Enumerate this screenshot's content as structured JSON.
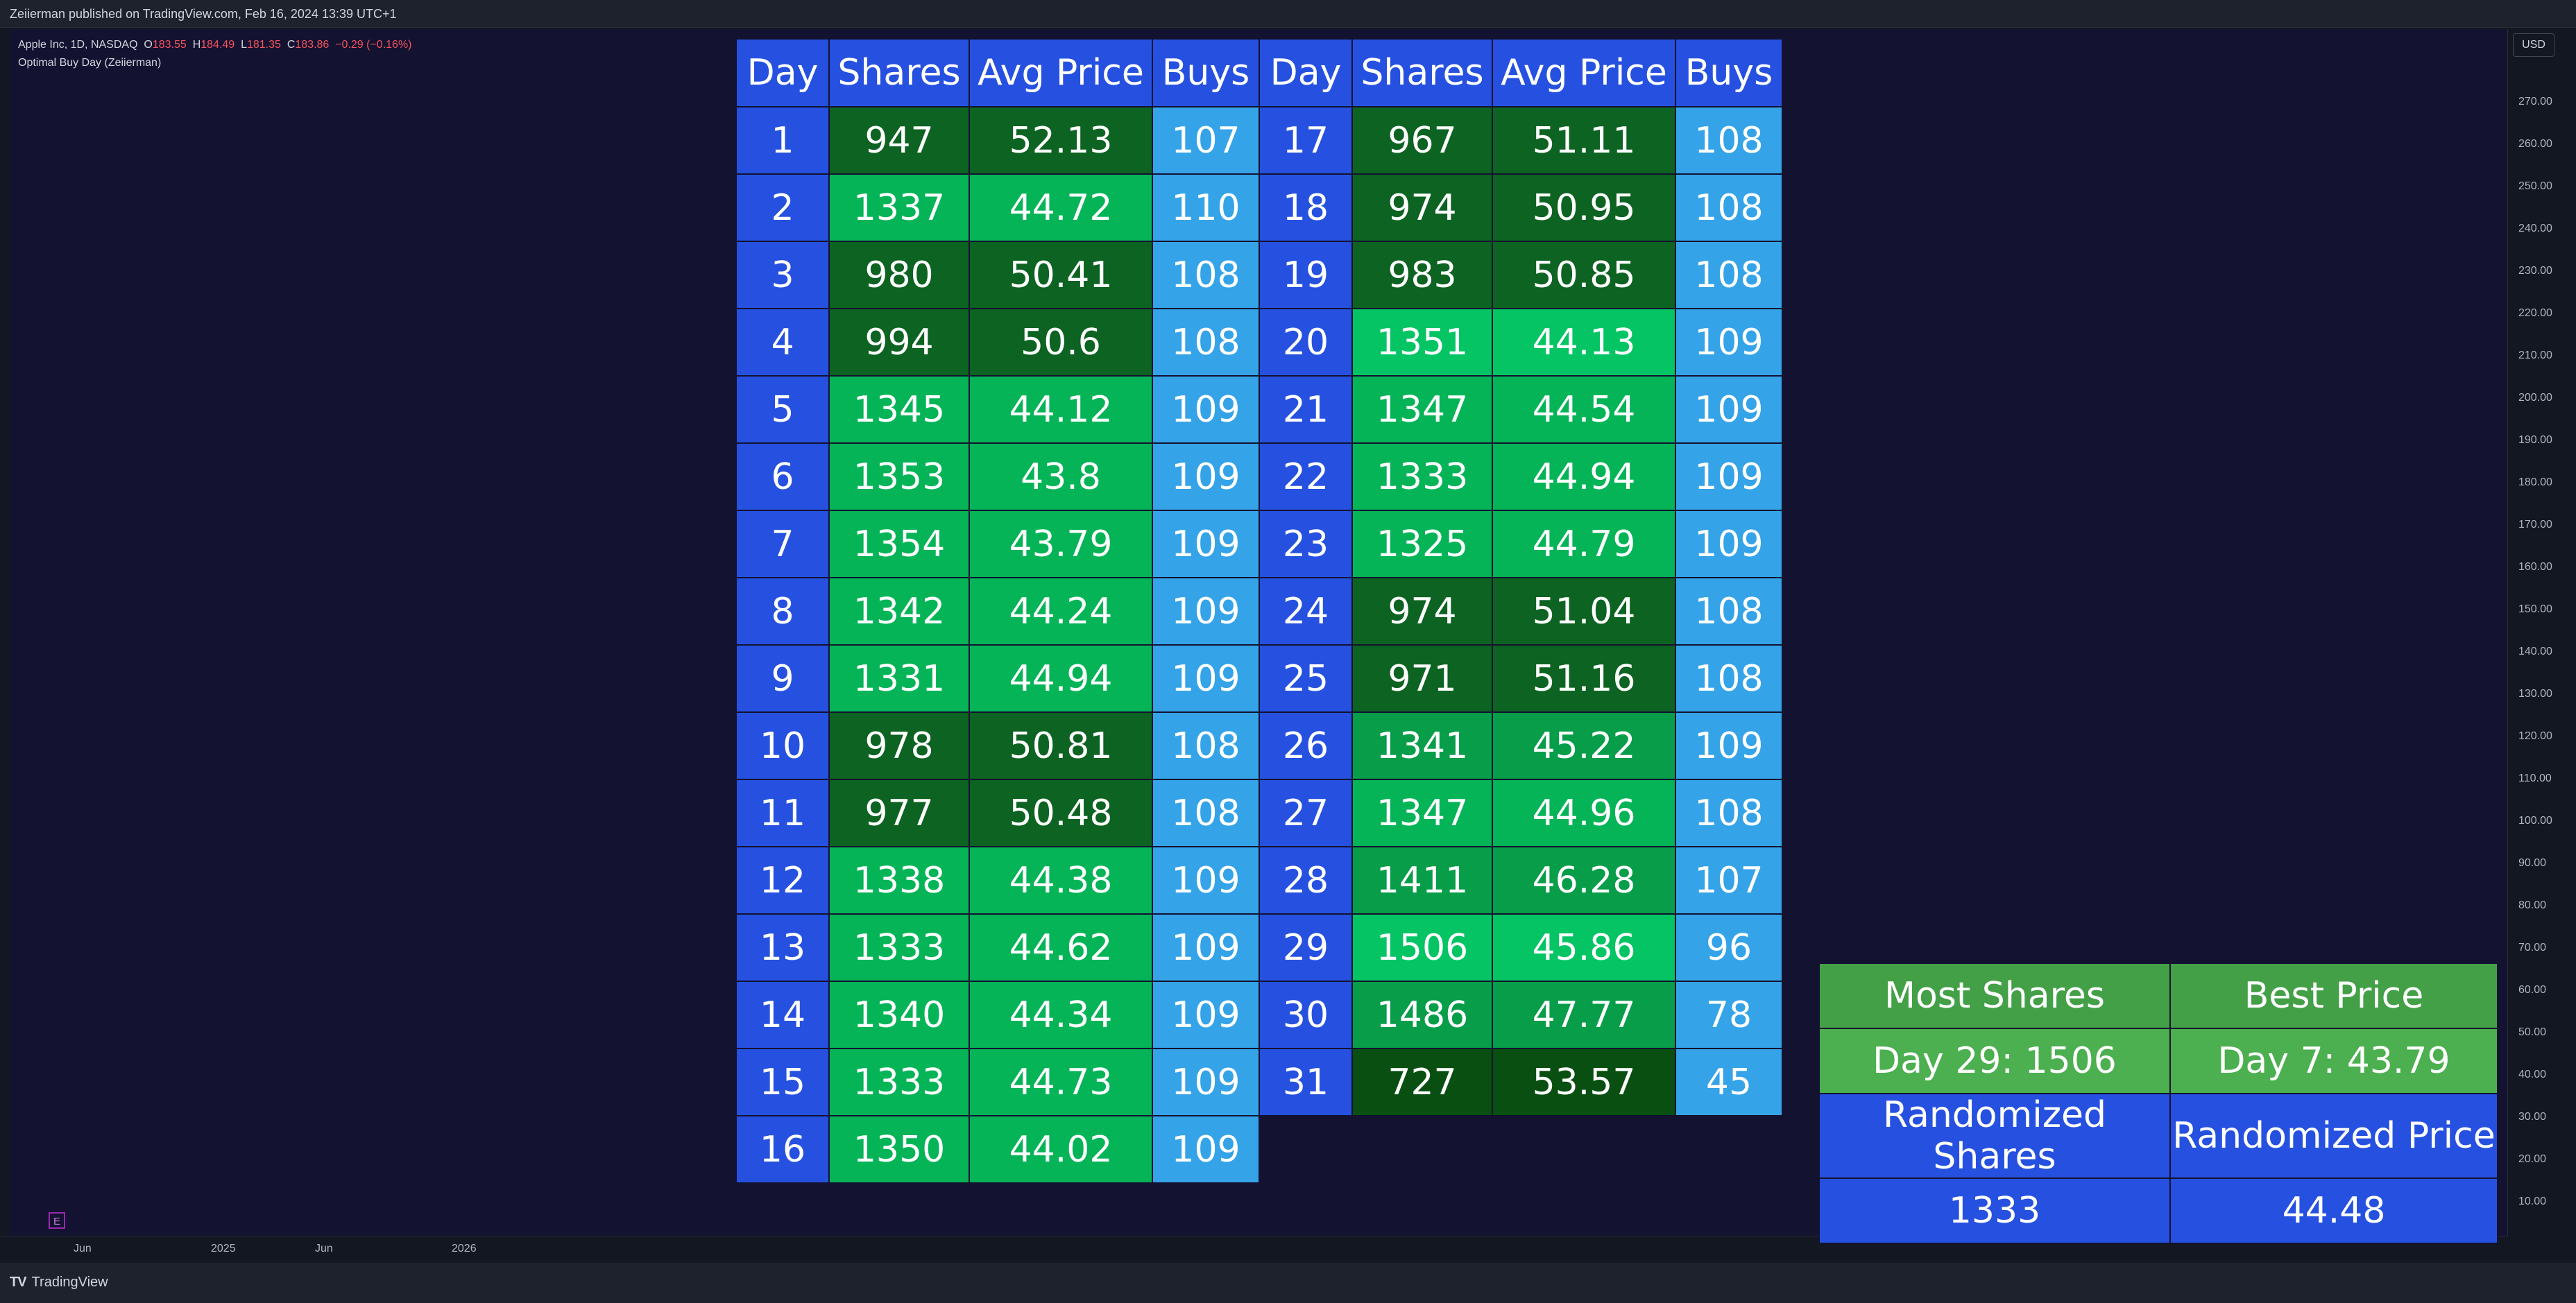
{
  "header": {
    "publish_line": "Zeiierman published on TradingView.com, Feb 16, 2024 13:39 UTC+1"
  },
  "legend": {
    "symbol": "Apple Inc, 1D, NASDAQ",
    "o_label": "O",
    "o": "183.55",
    "h_label": "H",
    "h": "184.49",
    "l_label": "L",
    "l": "181.35",
    "c_label": "C",
    "c": "183.86",
    "change": "−0.29 (−0.16%)",
    "indicator": "Optimal Buy Day (Zeiierman)"
  },
  "price_axis": {
    "currency": "USD",
    "ticks": [
      "270.00",
      "260.00",
      "250.00",
      "240.00",
      "230.00",
      "220.00",
      "210.00",
      "200.00",
      "190.00",
      "180.00",
      "170.00",
      "160.00",
      "150.00",
      "140.00",
      "130.00",
      "120.00",
      "110.00",
      "100.00",
      "90.00",
      "80.00",
      "70.00",
      "60.00",
      "50.00",
      "40.00",
      "30.00",
      "20.00",
      "10.00"
    ]
  },
  "time_axis": {
    "ticks": [
      "Jun",
      "2025",
      "Jun",
      "2026"
    ]
  },
  "earnings_badge": "E",
  "footer": {
    "logo_mark": "TV",
    "logo_text": "TradingView"
  },
  "colors": {
    "day": "#2651e0",
    "buys": "#35a3e8",
    "shares_scale": [
      "#0a4f12",
      "#0d6321",
      "#0a7a2c",
      "#079d49",
      "#05b457",
      "#04c464"
    ]
  },
  "table": {
    "headers": [
      "Day",
      "Shares",
      "Avg Price",
      "Buys",
      "Day",
      "Shares",
      "Avg Price",
      "Buys"
    ],
    "left": [
      {
        "day": "1",
        "shares": "947",
        "avg": "52.13",
        "buys": "107",
        "shade": 1,
        "bshade": 0
      },
      {
        "day": "2",
        "shares": "1337",
        "avg": "44.72",
        "buys": "110",
        "shade": 4,
        "bshade": 0
      },
      {
        "day": "3",
        "shares": "980",
        "avg": "50.41",
        "buys": "108",
        "shade": 1,
        "bshade": 0
      },
      {
        "day": "4",
        "shares": "994",
        "avg": "50.6",
        "buys": "108",
        "shade": 1,
        "bshade": 0
      },
      {
        "day": "5",
        "shares": "1345",
        "avg": "44.12",
        "buys": "109",
        "shade": 4,
        "bshade": 0
      },
      {
        "day": "6",
        "shares": "1353",
        "avg": "43.8",
        "buys": "109",
        "shade": 4,
        "bshade": 0
      },
      {
        "day": "7",
        "shares": "1354",
        "avg": "43.79",
        "buys": "109",
        "shade": 4,
        "bshade": 0
      },
      {
        "day": "8",
        "shares": "1342",
        "avg": "44.24",
        "buys": "109",
        "shade": 4,
        "bshade": 0
      },
      {
        "day": "9",
        "shares": "1331",
        "avg": "44.94",
        "buys": "109",
        "shade": 4,
        "bshade": 0
      },
      {
        "day": "10",
        "shares": "978",
        "avg": "50.81",
        "buys": "108",
        "shade": 1,
        "bshade": 0
      },
      {
        "day": "11",
        "shares": "977",
        "avg": "50.48",
        "buys": "108",
        "shade": 1,
        "bshade": 0
      },
      {
        "day": "12",
        "shares": "1338",
        "avg": "44.38",
        "buys": "109",
        "shade": 4,
        "bshade": 0
      },
      {
        "day": "13",
        "shares": "1333",
        "avg": "44.62",
        "buys": "109",
        "shade": 4,
        "bshade": 0
      },
      {
        "day": "14",
        "shares": "1340",
        "avg": "44.34",
        "buys": "109",
        "shade": 4,
        "bshade": 0
      },
      {
        "day": "15",
        "shares": "1333",
        "avg": "44.73",
        "buys": "109",
        "shade": 4,
        "bshade": 0
      },
      {
        "day": "16",
        "shares": "1350",
        "avg": "44.02",
        "buys": "109",
        "shade": 4,
        "bshade": 0
      }
    ],
    "right": [
      {
        "day": "17",
        "shares": "967",
        "avg": "51.11",
        "buys": "108",
        "shade": 1
      },
      {
        "day": "18",
        "shares": "974",
        "avg": "50.95",
        "buys": "108",
        "shade": 1
      },
      {
        "day": "19",
        "shares": "983",
        "avg": "50.85",
        "buys": "108",
        "shade": 1
      },
      {
        "day": "20",
        "shares": "1351",
        "avg": "44.13",
        "buys": "109",
        "shade": 5
      },
      {
        "day": "21",
        "shares": "1347",
        "avg": "44.54",
        "buys": "109",
        "shade": 4
      },
      {
        "day": "22",
        "shares": "1333",
        "avg": "44.94",
        "buys": "109",
        "shade": 4
      },
      {
        "day": "23",
        "shares": "1325",
        "avg": "44.79",
        "buys": "109",
        "shade": 4
      },
      {
        "day": "24",
        "shares": "974",
        "avg": "51.04",
        "buys": "108",
        "shade": 1
      },
      {
        "day": "25",
        "shares": "971",
        "avg": "51.16",
        "buys": "108",
        "shade": 1
      },
      {
        "day": "26",
        "shares": "1341",
        "avg": "45.22",
        "buys": "109",
        "shade": 3
      },
      {
        "day": "27",
        "shares": "1347",
        "avg": "44.96",
        "buys": "108",
        "shade": 4
      },
      {
        "day": "28",
        "shares": "1411",
        "avg": "46.28",
        "buys": "107",
        "shade": 3
      },
      {
        "day": "29",
        "shares": "1506",
        "avg": "45.86",
        "buys": "96",
        "shade": 5
      },
      {
        "day": "30",
        "shares": "1486",
        "avg": "47.77",
        "buys": "78",
        "shade": 3
      },
      {
        "day": "31",
        "shares": "727",
        "avg": "53.57",
        "buys": "45",
        "shade": 0
      }
    ]
  },
  "summary": {
    "most_shares_label": "Most Shares",
    "best_price_label": "Best Price",
    "most_shares_value": "Day 29: 1506",
    "best_price_value": "Day 7: 43.79",
    "randomized_shares_label": "Randomized Shares",
    "randomized_price_label": "Randomized Price",
    "randomized_shares_value": "1333",
    "randomized_price_value": "44.48"
  }
}
